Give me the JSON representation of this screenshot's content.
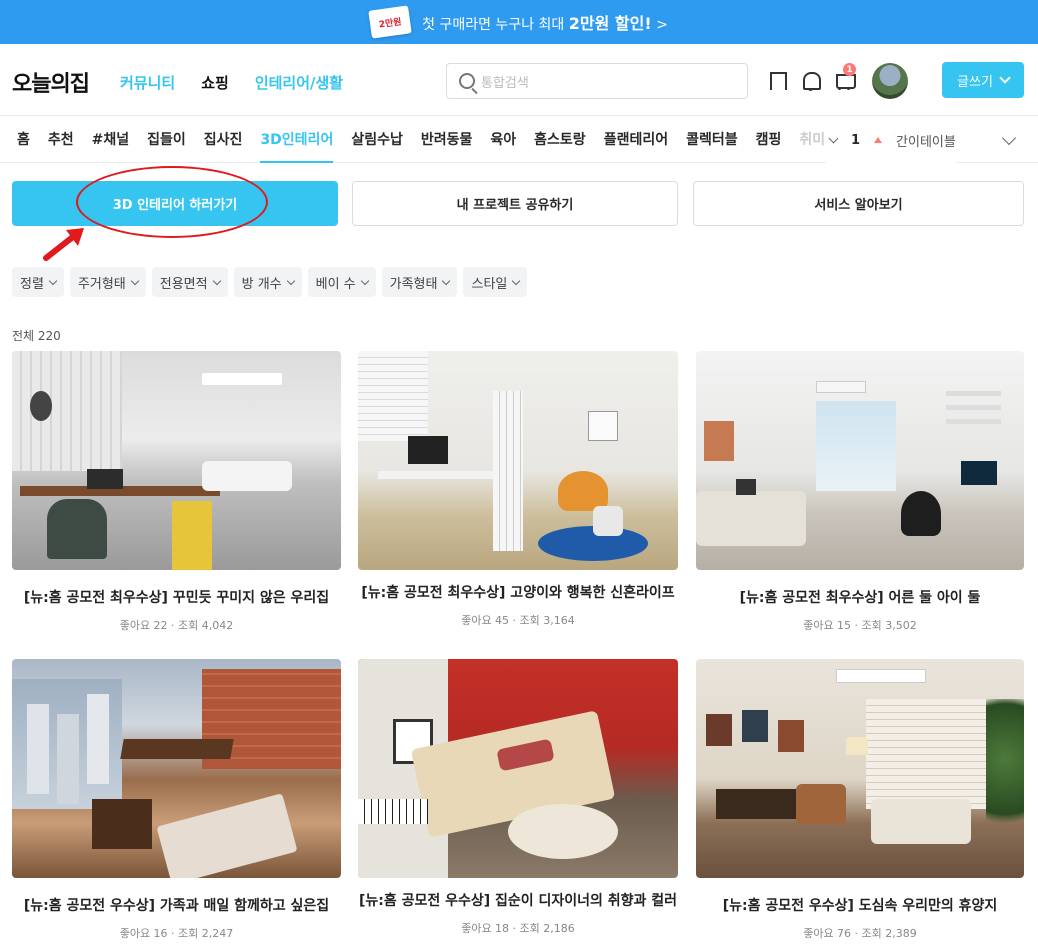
{
  "banner": {
    "badge": "2만원",
    "text_prefix": "첫 구매라면 누구나 최대 ",
    "text_bold": "2만원 할인!",
    "chevron": ">"
  },
  "header": {
    "logo": "오늘의집",
    "nav": [
      "커뮤니티",
      "쇼핑",
      "인테리어/생활"
    ],
    "search_placeholder": "통합검색",
    "cart_count": "1",
    "write_button": "글쓰기"
  },
  "subnav": {
    "items": [
      "홈",
      "추천",
      "#채널",
      "집들이",
      "집사진",
      "3D인테리어",
      "살림수납",
      "반려동물",
      "육아",
      "홈스토랑",
      "플랜테리어",
      "콜렉터블",
      "캠핑",
      "취미"
    ],
    "active_index": 5,
    "ranking_number": "1",
    "ranking_text": "간이테이블"
  },
  "actions": {
    "primary": "3D 인테리어 하러가기",
    "share": "내 프로젝트 공유하기",
    "service": "서비스 알아보기"
  },
  "filters": [
    "정렬",
    "주거형태",
    "전용면적",
    "방 개수",
    "베이 수",
    "가족형태",
    "스타일"
  ],
  "total_label": "전체 220",
  "cards": [
    {
      "title": "[뉴:홈 공모전 최우수상] 꾸민듯 꾸미지 않은 우리집",
      "meta": "좋아요 22 · 조회 4,042"
    },
    {
      "title": "[뉴:홈 공모전 최우수상] 고양이와 행복한 신혼라이프",
      "meta": "좋아요 45 · 조회 3,164"
    },
    {
      "title": "[뉴:홈 공모전 최우수상] 어른 둘 아이 둘",
      "meta": "좋아요 15 · 조회 3,502"
    },
    {
      "title": "[뉴:홈 공모전 우수상] 가족과 매일 함께하고 싶은집",
      "meta": "좋아요 16 · 조회 2,247"
    },
    {
      "title": "[뉴:홈 공모전 우수상] 집순이 디자이너의 취향과 컬러",
      "meta": "좋아요 18 · 조회 2,186"
    },
    {
      "title": "[뉴:홈 공모전 우수상] 도심속 우리만의 휴양지",
      "meta": "좋아요 76 · 조회 2,389"
    }
  ],
  "colors": {
    "accent": "#35c5f0",
    "banner": "#2f9bf0",
    "annotation_red": "#e0191c"
  },
  "icons": [
    "search-icon",
    "bookmark-icon",
    "bell-icon",
    "cart-icon",
    "chevron-down-icon"
  ]
}
